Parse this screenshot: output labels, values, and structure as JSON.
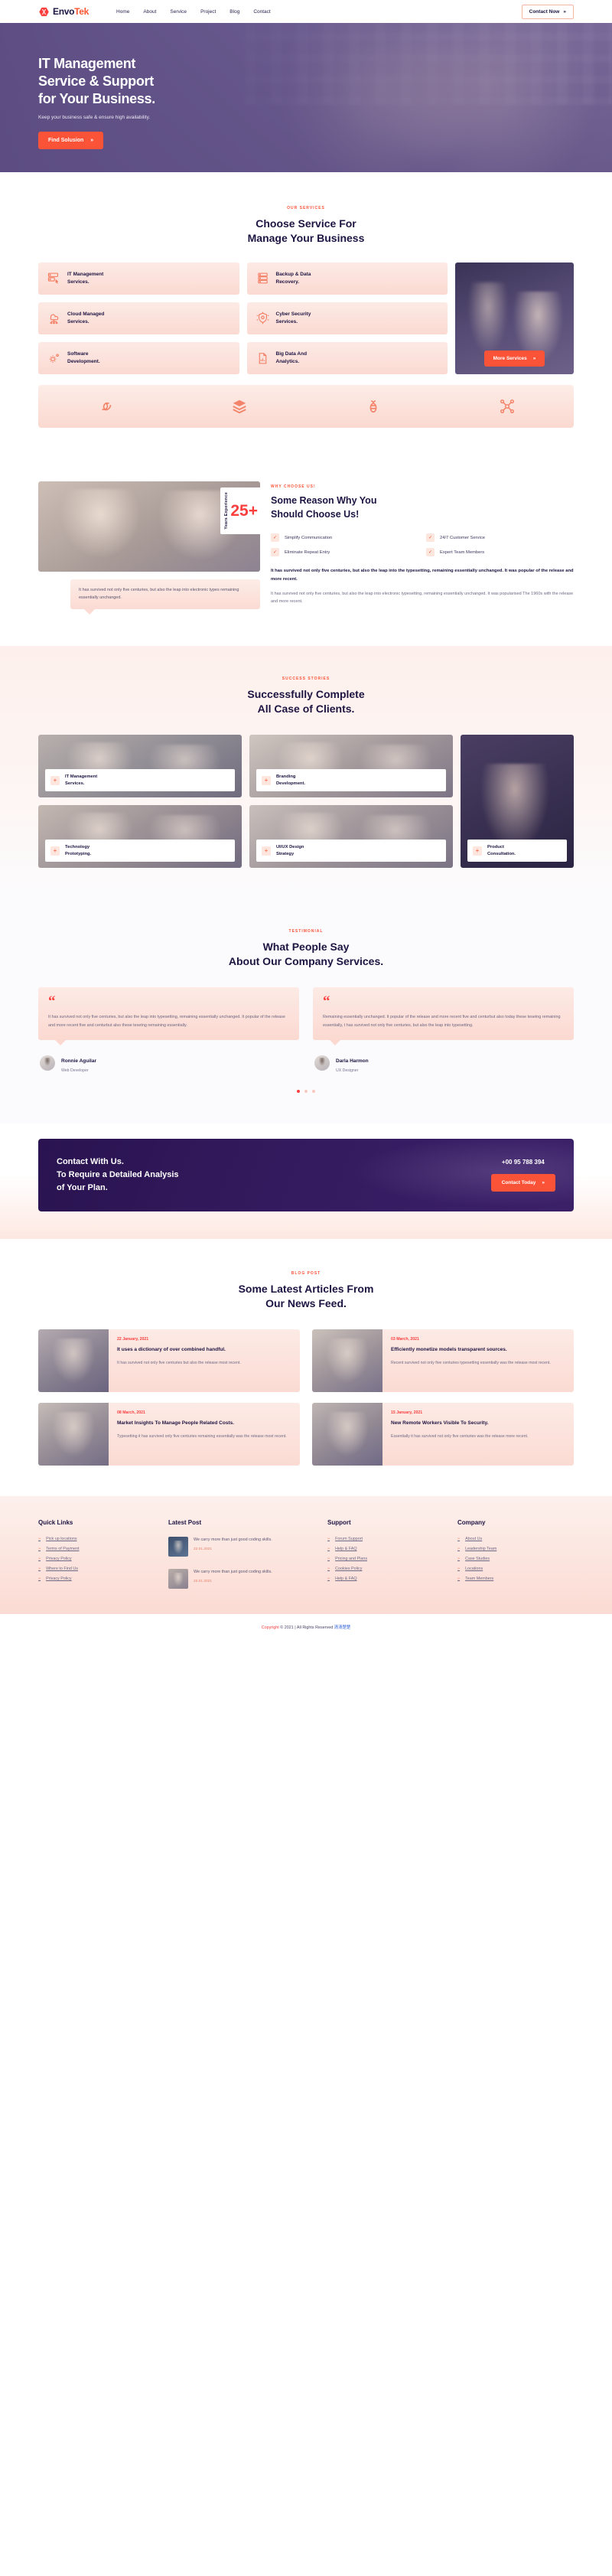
{
  "brand": {
    "name_dark": "Envo",
    "name_accent": "Tek",
    "logo_icon": "hexagon-logo-icon"
  },
  "header": {
    "nav": [
      {
        "label": "Home"
      },
      {
        "label": "About"
      },
      {
        "label": "Service"
      },
      {
        "label": "Project"
      },
      {
        "label": "Blog"
      },
      {
        "label": "Contact"
      }
    ],
    "cta_label": "Contact Now",
    "cta_arrow": "»"
  },
  "hero": {
    "title_line1": "IT Management",
    "title_line2": "Service & Support",
    "title_line3": "for Your Business.",
    "subtitle": "Keep your business safe & ensure high availability.",
    "button_label": "Find Solusion",
    "button_arrow": "»"
  },
  "services": {
    "eyebrow": "OUR SERVICES",
    "title_line1": "Choose Service For",
    "title_line2": "Manage Your Business",
    "cards_left": [
      {
        "label": "IT Management\nServices.",
        "icon": "server-click-icon"
      },
      {
        "label": "Cloud Managed\nServices.",
        "icon": "cloud-network-icon"
      },
      {
        "label": "Software\nDevelopment.",
        "icon": "gear-code-icon"
      }
    ],
    "cards_right": [
      {
        "label": "Backup & Data\nRecovery.",
        "icon": "database-rack-icon"
      },
      {
        "label": "Cyber Security\nServices.",
        "icon": "shield-lock-icon"
      },
      {
        "label": "Big Data And\nAnalytics.",
        "icon": "document-chart-icon"
      }
    ],
    "more_button": "More Services",
    "more_arrow": "»"
  },
  "brands": [
    {
      "name": "spiral-brand-icon"
    },
    {
      "name": "layers-brand-icon"
    },
    {
      "name": "bee-brand-icon"
    },
    {
      "name": "molecule-brand-icon"
    }
  ],
  "why": {
    "eyebrow": "WHY CHOOSE US!",
    "years_number": "25+",
    "years_label": "Years Experience",
    "quote": "It has survived not only five centuries, but also the leap into electronic types remaining essentially unchanged.",
    "title_line1": "Some Reason Why You",
    "title_line2": "Should Choose Us!",
    "features": [
      {
        "label": "Simplify Communication"
      },
      {
        "label": "24/7 Customer Service"
      },
      {
        "label": "Eliminate Repeat Entry"
      },
      {
        "label": "Expert Team Members"
      }
    ],
    "lead": "It has survived not only five centuries, but also the leap into the typesetting, remaining essentially unchanged. It was popular of the release and more recent.",
    "body": "It has survived not only five centuries, but also the leap into electronic typesetting, remaining essentially unchanged. It was popularised The 1960s with the release and more recent."
  },
  "success": {
    "eyebrow": "SUCCESS STORIES",
    "title_line1": "Successfully Complete",
    "title_line2": "All Case of Clients.",
    "cases": [
      {
        "label": "IT Management\nServices."
      },
      {
        "label": "Branding\nDevelopment."
      },
      {
        "label": "Technology\nPrototyping."
      },
      {
        "label": "UI/UX Design\nStrategy"
      },
      {
        "label": "Product\nConsultation."
      }
    ],
    "plus": "+"
  },
  "testimonials": {
    "eyebrow": "TESTIMONIAL",
    "title_line1": "What People Say",
    "title_line2": "About Our Company Services.",
    "quote_glyph": "“",
    "items": [
      {
        "text": "It has survived not only five centuries, but also the leap into typesetting, remaining essentially unchanged. It popular of the release and more recent five and centurbut also these tesetng remaining essentially.",
        "name": "Ronnie Aguilar",
        "role": "Web Developer"
      },
      {
        "text": "Remaining essentially unchanged. It popular of the release and more recent five and centurbut also today these tesetng remaining essentially, t has survived not only five centuries, but also the leap into typesetting.",
        "name": "Darla Harmon",
        "role": "UX Designer"
      }
    ],
    "dots": [
      true,
      false,
      false
    ]
  },
  "cta": {
    "line1": "Contact With Us.",
    "line2": "To Require a Detailed Analysis",
    "line3": "of Your Plan.",
    "phone": "+00 95 788 394",
    "button_label": "Contact Today",
    "button_arrow": "»"
  },
  "blog": {
    "eyebrow": "BLOG POST",
    "title_line1": "Some Latest Articles From",
    "title_line2": "Our News Feed.",
    "posts": [
      {
        "date": "22 January, 2021",
        "title": "It uses a dictionary of over combined handful.",
        "excerpt": "It has survived not only five centuries but also the release most recent."
      },
      {
        "date": "03 March, 2021",
        "title": "Efficiently monetize models transparent sources.",
        "excerpt": "Recent survived not only five centuries typesetting essentially was the release most recent."
      },
      {
        "date": "08 March, 2021",
        "title": "Market Insights To Manage People Related Costs.",
        "excerpt": "Typesetting it has survived only five centuries remaining essentially was the release most recent."
      },
      {
        "date": "15 January, 2021",
        "title": "New Remote Workers Visible To Security.",
        "excerpt": "Essentially it has survived not only five centuries was the release more recent."
      }
    ]
  },
  "footer": {
    "columns": [
      {
        "heading": "Quick Links",
        "items": [
          "Pick up locations",
          "Terms of Payment",
          "Privacy Policy",
          "Where to Find Us",
          "Privacy Policy"
        ]
      },
      {
        "heading": "Support",
        "items": [
          "Forum Support",
          "Help & FAQ",
          "Pricing and Plans",
          "Cookies Policy",
          "Help & FAQ"
        ]
      },
      {
        "heading": "Company",
        "items": [
          "About Us",
          "Leadership Team",
          "Case Studies",
          "Locations",
          "Team Members"
        ]
      }
    ],
    "latest_heading": "Latest Post",
    "latest_posts": [
      {
        "title": "We carry more than just good coding skills.",
        "date": "22.01.2021"
      },
      {
        "title": "We carry more than just good coding skills.",
        "date": "22.01.2021"
      }
    ],
    "arrow": "»",
    "copyright_prefix": "Copyright",
    "copyright_mid": "© 2021 | All Rights Reserved",
    "copyright_link": "清清楚楚"
  },
  "colors": {
    "accent": "#fa5338",
    "red": "#fa3f3f",
    "dark": "#1d1442",
    "purple": "#2a1350"
  }
}
